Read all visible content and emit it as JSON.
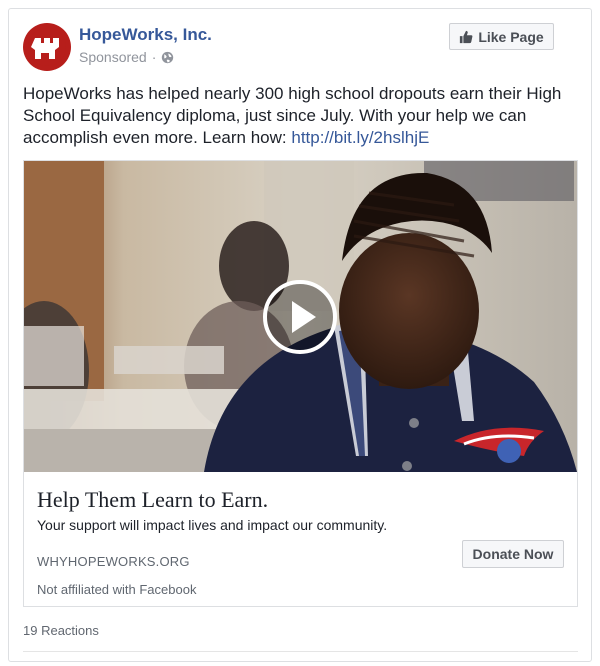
{
  "page": {
    "name": "HopeWorks, Inc.",
    "sponsored_label": "Sponsored",
    "separator": "·",
    "logo_icon": "hopeworks-logo",
    "globe_icon": "globe-icon"
  },
  "like_button": {
    "label": "Like Page",
    "icon": "thumbs-up-icon"
  },
  "post": {
    "text": "HopeWorks has helped nearly 300 high school dropouts earn their High School Equivalency diploma, just since July. With your help we can accomplish even more. Learn how: ",
    "link": "http://bit.ly/2hslhjE"
  },
  "ad": {
    "video_icon": "play-icon",
    "headline": "Help Them Learn to Earn.",
    "description": "Your support will impact lives and impact our community.",
    "domain": "WHYHOPEWORKS.ORG",
    "cta_label": "Donate Now",
    "disclaimer": "Not affiliated with Facebook"
  },
  "footer": {
    "reactions": "19 Reactions"
  },
  "colors": {
    "link_blue": "#365899",
    "brand_red": "#b71e1b",
    "border": "#dddfe2"
  }
}
